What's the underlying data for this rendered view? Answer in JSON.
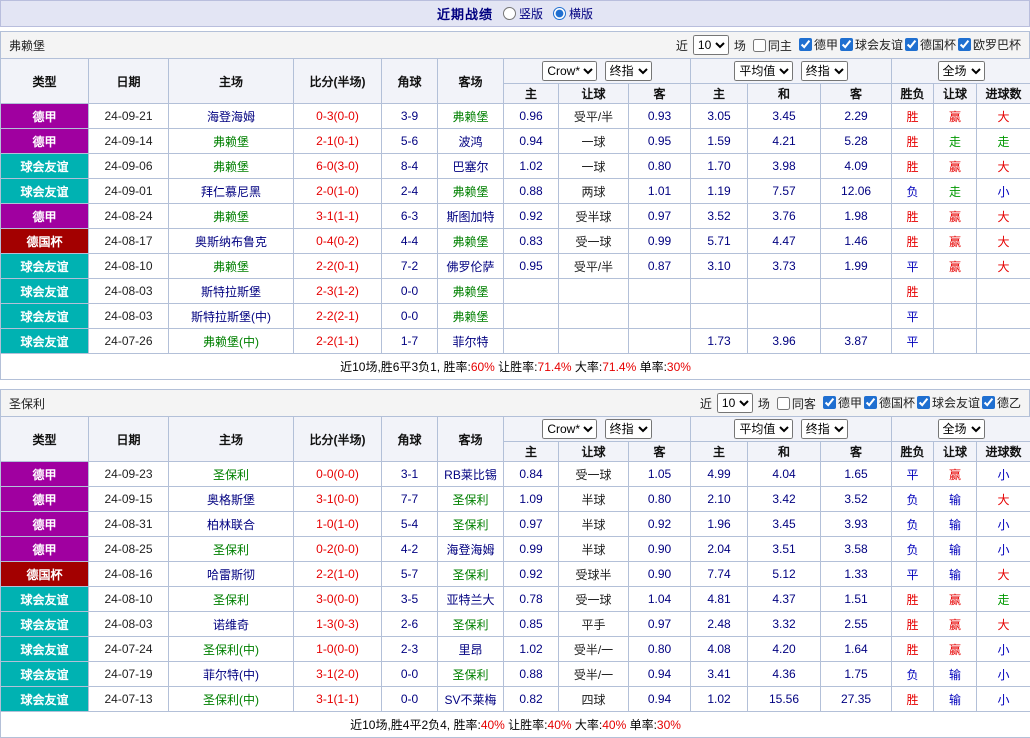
{
  "colors": {
    "league": {
      "德甲": "#a000a0",
      "球会友谊": "#00b2b2",
      "德国杯": "#a30000"
    },
    "result": {
      "胜": "#e60000",
      "平": "#0000bb",
      "负": "#0000bb",
      "赢": "#e60000",
      "输": "#0000bb",
      "走": "#009900",
      "大": "#e60000",
      "小": "#0000bb"
    },
    "focus_team": "#008000",
    "team": "#000080",
    "score_red": "#e60000",
    "topbar_bg": "#e3e5f4",
    "header_bg": "#f2f3f9",
    "border": "#b3c0d8"
  },
  "topbar": {
    "title": "近期战绩",
    "options": [
      {
        "label": "竖版",
        "checked": false
      },
      {
        "label": "横版",
        "checked": true
      }
    ]
  },
  "controls_labels": {
    "recent": "近",
    "matches": "场"
  },
  "table_header": {
    "type": "类型",
    "date": "日期",
    "home": "主场",
    "score": "比分(半场)",
    "corner": "角球",
    "away": "客场",
    "odds_company": "Crow*",
    "odds_stage": "终指",
    "avg_type": "平均值",
    "avg_stage": "终指",
    "scope": "全场",
    "sub": [
      "主",
      "让球",
      "客",
      "主",
      "和",
      "客",
      "胜负",
      "让球",
      "进球数"
    ]
  },
  "sections": [
    {
      "team": "弗赖堡",
      "controls": {
        "count": "10",
        "same": {
          "label": "同主",
          "checked": false
        },
        "leagues": [
          {
            "label": "德甲",
            "checked": true
          },
          {
            "label": "球会友谊",
            "checked": true
          },
          {
            "label": "德国杯",
            "checked": true
          },
          {
            "label": "欧罗巴杯",
            "checked": true
          }
        ]
      },
      "rows": [
        {
          "league": "德甲",
          "date": "24-09-21",
          "home": "海登海姆",
          "home_focus": false,
          "score": "0-3(0-0)",
          "corner": "3-9",
          "away": "弗赖堡",
          "away_focus": true,
          "odds_home": "0.96",
          "handicap": "受平/半",
          "odds_away": "0.93",
          "avg_home": "3.05",
          "avg_draw": "3.45",
          "avg_away": "2.29",
          "wdl": "胜",
          "handicap_result": "赢",
          "goals": "大"
        },
        {
          "league": "德甲",
          "date": "24-09-14",
          "home": "弗赖堡",
          "home_focus": true,
          "score": "2-1(0-1)",
          "corner": "5-6",
          "away": "波鸿",
          "away_focus": false,
          "odds_home": "0.94",
          "handicap": "一球",
          "odds_away": "0.95",
          "avg_home": "1.59",
          "avg_draw": "4.21",
          "avg_away": "5.28",
          "wdl": "胜",
          "handicap_result": "走",
          "goals": "走"
        },
        {
          "league": "球会友谊",
          "date": "24-09-06",
          "home": "弗赖堡",
          "home_focus": true,
          "score": "6-0(3-0)",
          "corner": "8-4",
          "away": "巴塞尔",
          "away_focus": false,
          "odds_home": "1.02",
          "handicap": "一球",
          "odds_away": "0.80",
          "avg_home": "1.70",
          "avg_draw": "3.98",
          "avg_away": "4.09",
          "wdl": "胜",
          "handicap_result": "赢",
          "goals": "大"
        },
        {
          "league": "球会友谊",
          "date": "24-09-01",
          "home": "拜仁慕尼黑",
          "home_focus": false,
          "score": "2-0(1-0)",
          "corner": "2-4",
          "away": "弗赖堡",
          "away_focus": true,
          "odds_home": "0.88",
          "handicap": "两球",
          "odds_away": "1.01",
          "avg_home": "1.19",
          "avg_draw": "7.57",
          "avg_away": "12.06",
          "wdl": "负",
          "handicap_result": "走",
          "goals": "小"
        },
        {
          "league": "德甲",
          "date": "24-08-24",
          "home": "弗赖堡",
          "home_focus": true,
          "score": "3-1(1-1)",
          "corner": "6-3",
          "away": "斯图加特",
          "away_focus": false,
          "odds_home": "0.92",
          "handicap": "受半球",
          "odds_away": "0.97",
          "avg_home": "3.52",
          "avg_draw": "3.76",
          "avg_away": "1.98",
          "wdl": "胜",
          "handicap_result": "赢",
          "goals": "大"
        },
        {
          "league": "德国杯",
          "date": "24-08-17",
          "home": "奥斯纳布鲁克",
          "home_focus": false,
          "score": "0-4(0-2)",
          "corner": "4-4",
          "away": "弗赖堡",
          "away_focus": true,
          "odds_home": "0.83",
          "handicap": "受一球",
          "odds_away": "0.99",
          "avg_home": "5.71",
          "avg_draw": "4.47",
          "avg_away": "1.46",
          "wdl": "胜",
          "handicap_result": "赢",
          "goals": "大"
        },
        {
          "league": "球会友谊",
          "date": "24-08-10",
          "home": "弗赖堡",
          "home_focus": true,
          "score": "2-2(0-1)",
          "corner": "7-2",
          "away": "佛罗伦萨",
          "away_focus": false,
          "odds_home": "0.95",
          "handicap": "受平/半",
          "odds_away": "0.87",
          "avg_home": "3.10",
          "avg_draw": "3.73",
          "avg_away": "1.99",
          "wdl": "平",
          "handicap_result": "赢",
          "goals": "大"
        },
        {
          "league": "球会友谊",
          "date": "24-08-03",
          "home": "斯特拉斯堡",
          "home_focus": false,
          "score": "2-3(1-2)",
          "corner": "0-0",
          "away": "弗赖堡",
          "away_focus": true,
          "odds_home": "",
          "handicap": "",
          "odds_away": "",
          "avg_home": "",
          "avg_draw": "",
          "avg_away": "",
          "wdl": "胜",
          "handicap_result": "",
          "goals": ""
        },
        {
          "league": "球会友谊",
          "date": "24-08-03",
          "home": "斯特拉斯堡(中)",
          "home_focus": false,
          "score": "2-2(2-1)",
          "corner": "0-0",
          "away": "弗赖堡",
          "away_focus": true,
          "odds_home": "",
          "handicap": "",
          "odds_away": "",
          "avg_home": "",
          "avg_draw": "",
          "avg_away": "",
          "wdl": "平",
          "handicap_result": "",
          "goals": ""
        },
        {
          "league": "球会友谊",
          "date": "24-07-26",
          "home": "弗赖堡(中)",
          "home_focus": true,
          "score": "2-2(1-1)",
          "corner": "1-7",
          "away": "菲尔特",
          "away_focus": false,
          "odds_home": "",
          "handicap": "",
          "odds_away": "",
          "avg_home": "1.73",
          "avg_draw": "3.96",
          "avg_away": "3.87",
          "wdl": "平",
          "handicap_result": "",
          "goals": ""
        }
      ],
      "summary": [
        {
          "text": "近10场,胜6平3负1, ",
          "red": false
        },
        {
          "text": "胜率:",
          "red": false
        },
        {
          "text": "60%",
          "red": true
        },
        {
          "text": " 让胜率:",
          "red": false
        },
        {
          "text": "71.4%",
          "red": true
        },
        {
          "text": " 大率:",
          "red": false
        },
        {
          "text": "71.4%",
          "red": true
        },
        {
          "text": " 单率:",
          "red": false
        },
        {
          "text": "30%",
          "red": true
        }
      ]
    },
    {
      "team": "圣保利",
      "controls": {
        "count": "10",
        "same": {
          "label": "同客",
          "checked": false
        },
        "leagues": [
          {
            "label": "德甲",
            "checked": true
          },
          {
            "label": "德国杯",
            "checked": true
          },
          {
            "label": "球会友谊",
            "checked": true
          },
          {
            "label": "德乙",
            "checked": true
          }
        ]
      },
      "rows": [
        {
          "league": "德甲",
          "date": "24-09-23",
          "home": "圣保利",
          "home_focus": true,
          "score": "0-0(0-0)",
          "corner": "3-1",
          "away": "RB莱比锡",
          "away_focus": false,
          "odds_home": "0.84",
          "handicap": "受一球",
          "odds_away": "1.05",
          "avg_home": "4.99",
          "avg_draw": "4.04",
          "avg_away": "1.65",
          "wdl": "平",
          "handicap_result": "赢",
          "goals": "小"
        },
        {
          "league": "德甲",
          "date": "24-09-15",
          "home": "奥格斯堡",
          "home_focus": false,
          "score": "3-1(0-0)",
          "corner": "7-7",
          "away": "圣保利",
          "away_focus": true,
          "odds_home": "1.09",
          "handicap": "半球",
          "odds_away": "0.80",
          "avg_home": "2.10",
          "avg_draw": "3.42",
          "avg_away": "3.52",
          "wdl": "负",
          "handicap_result": "输",
          "goals": "大"
        },
        {
          "league": "德甲",
          "date": "24-08-31",
          "home": "柏林联合",
          "home_focus": false,
          "score": "1-0(1-0)",
          "corner": "5-4",
          "away": "圣保利",
          "away_focus": true,
          "odds_home": "0.97",
          "handicap": "半球",
          "odds_away": "0.92",
          "avg_home": "1.96",
          "avg_draw": "3.45",
          "avg_away": "3.93",
          "wdl": "负",
          "handicap_result": "输",
          "goals": "小"
        },
        {
          "league": "德甲",
          "date": "24-08-25",
          "home": "圣保利",
          "home_focus": true,
          "score": "0-2(0-0)",
          "corner": "4-2",
          "away": "海登海姆",
          "away_focus": false,
          "odds_home": "0.99",
          "handicap": "半球",
          "odds_away": "0.90",
          "avg_home": "2.04",
          "avg_draw": "3.51",
          "avg_away": "3.58",
          "wdl": "负",
          "handicap_result": "输",
          "goals": "小"
        },
        {
          "league": "德国杯",
          "date": "24-08-16",
          "home": "哈雷斯彻",
          "home_focus": false,
          "score": "2-2(1-0)",
          "corner": "5-7",
          "away": "圣保利",
          "away_focus": true,
          "odds_home": "0.92",
          "handicap": "受球半",
          "odds_away": "0.90",
          "avg_home": "7.74",
          "avg_draw": "5.12",
          "avg_away": "1.33",
          "wdl": "平",
          "handicap_result": "输",
          "goals": "大"
        },
        {
          "league": "球会友谊",
          "date": "24-08-10",
          "home": "圣保利",
          "home_focus": true,
          "score": "3-0(0-0)",
          "corner": "3-5",
          "away": "亚特兰大",
          "away_focus": false,
          "odds_home": "0.78",
          "handicap": "受一球",
          "odds_away": "1.04",
          "avg_home": "4.81",
          "avg_draw": "4.37",
          "avg_away": "1.51",
          "wdl": "胜",
          "handicap_result": "赢",
          "goals": "走"
        },
        {
          "league": "球会友谊",
          "date": "24-08-03",
          "home": "诺维奇",
          "home_focus": false,
          "score": "1-3(0-3)",
          "corner": "2-6",
          "away": "圣保利",
          "away_focus": true,
          "odds_home": "0.85",
          "handicap": "平手",
          "odds_away": "0.97",
          "avg_home": "2.48",
          "avg_draw": "3.32",
          "avg_away": "2.55",
          "wdl": "胜",
          "handicap_result": "赢",
          "goals": "大"
        },
        {
          "league": "球会友谊",
          "date": "24-07-24",
          "home": "圣保利(中)",
          "home_focus": true,
          "score": "1-0(0-0)",
          "corner": "2-3",
          "away": "里昂",
          "away_focus": false,
          "odds_home": "1.02",
          "handicap": "受半/一",
          "odds_away": "0.80",
          "avg_home": "4.08",
          "avg_draw": "4.20",
          "avg_away": "1.64",
          "wdl": "胜",
          "handicap_result": "赢",
          "goals": "小"
        },
        {
          "league": "球会友谊",
          "date": "24-07-19",
          "home": "菲尔特(中)",
          "home_focus": false,
          "score": "3-1(2-0)",
          "corner": "0-0",
          "away": "圣保利",
          "away_focus": true,
          "odds_home": "0.88",
          "handicap": "受半/一",
          "odds_away": "0.94",
          "avg_home": "3.41",
          "avg_draw": "4.36",
          "avg_away": "1.75",
          "wdl": "负",
          "handicap_result": "输",
          "goals": "小"
        },
        {
          "league": "球会友谊",
          "date": "24-07-13",
          "home": "圣保利(中)",
          "home_focus": true,
          "score": "3-1(1-1)",
          "corner": "0-0",
          "away": "SV不莱梅",
          "away_focus": false,
          "odds_home": "0.82",
          "handicap": "四球",
          "odds_away": "0.94",
          "avg_home": "1.02",
          "avg_draw": "15.56",
          "avg_away": "27.35",
          "wdl": "胜",
          "handicap_result": "输",
          "goals": "小"
        }
      ],
      "summary": [
        {
          "text": "近10场,胜4平2负4, ",
          "red": false
        },
        {
          "text": "胜率:",
          "red": false
        },
        {
          "text": "40%",
          "red": true
        },
        {
          "text": " 让胜率:",
          "red": false
        },
        {
          "text": "40%",
          "red": true
        },
        {
          "text": " 大率:",
          "red": false
        },
        {
          "text": "40%",
          "red": true
        },
        {
          "text": " 单率:",
          "red": false
        },
        {
          "text": "30%",
          "red": true
        }
      ]
    }
  ]
}
